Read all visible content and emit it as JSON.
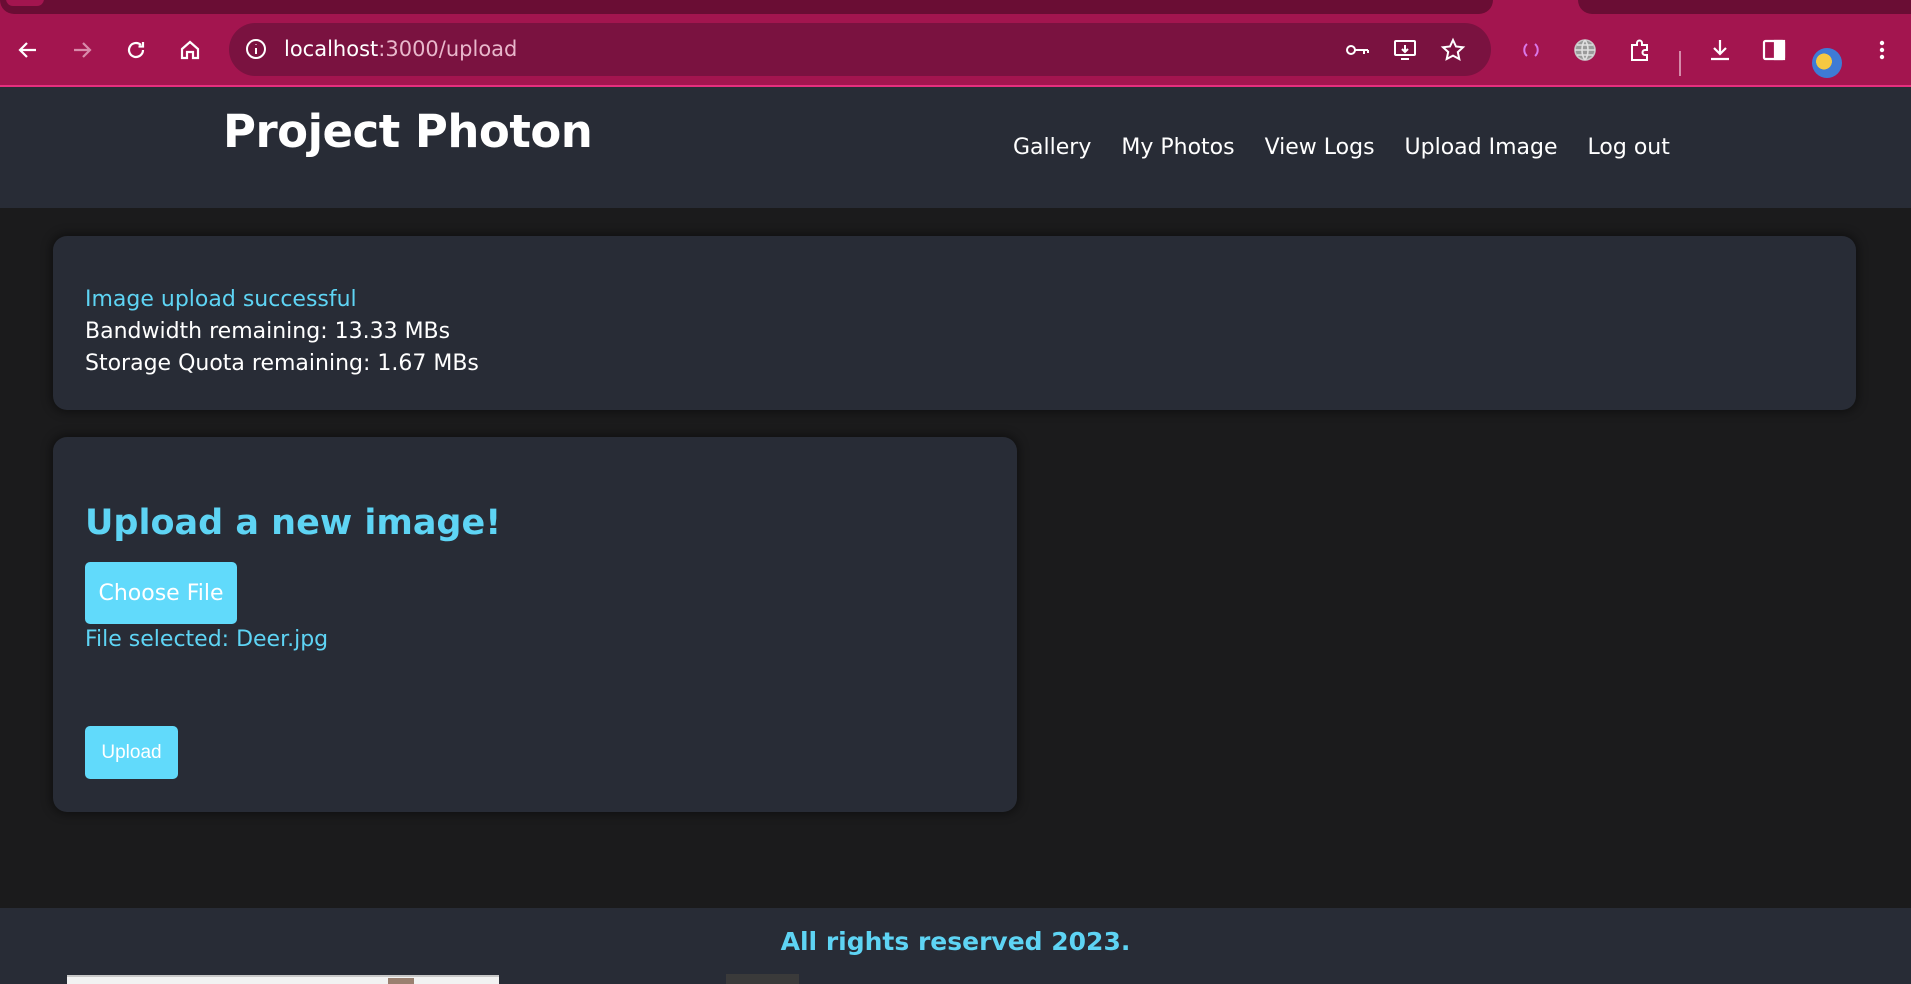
{
  "browser": {
    "url_host": "localhost",
    "url_path": ":3000/upload",
    "colors": {
      "frame": "#a3154f",
      "omnibox": "#7a1240"
    },
    "icons": [
      "back-arrow-icon",
      "forward-arrow-icon",
      "reload-icon",
      "home-icon",
      "site-info-icon",
      "password-key-icon",
      "install-app-icon",
      "bookmark-star-icon",
      "extension-loader-icon",
      "globe-icon",
      "puzzle-extensions-icon",
      "download-icon",
      "side-panel-icon",
      "profile-avatar",
      "more-menu-icon"
    ]
  },
  "header": {
    "brand": "Project Photon",
    "nav": [
      "Gallery",
      "My Photos",
      "View Logs",
      "Upload Image",
      "Log out"
    ]
  },
  "status": {
    "message": "Image upload successful",
    "bandwidth": "Bandwidth remaining: 13.33 MBs",
    "storage": "Storage Quota remaining: 1.67 MBs"
  },
  "upload": {
    "heading": "Upload a new image!",
    "choose_label": "Choose File",
    "file_selected": "File selected: Deer.jpg",
    "upload_label": "Upload"
  },
  "footer": {
    "copyright": "All rights reserved 2023."
  },
  "colors": {
    "accent": "#61dafb",
    "accent_text": "#5ed4f4",
    "card_bg": "#282c36",
    "page_bg": "#1b1b1c"
  }
}
